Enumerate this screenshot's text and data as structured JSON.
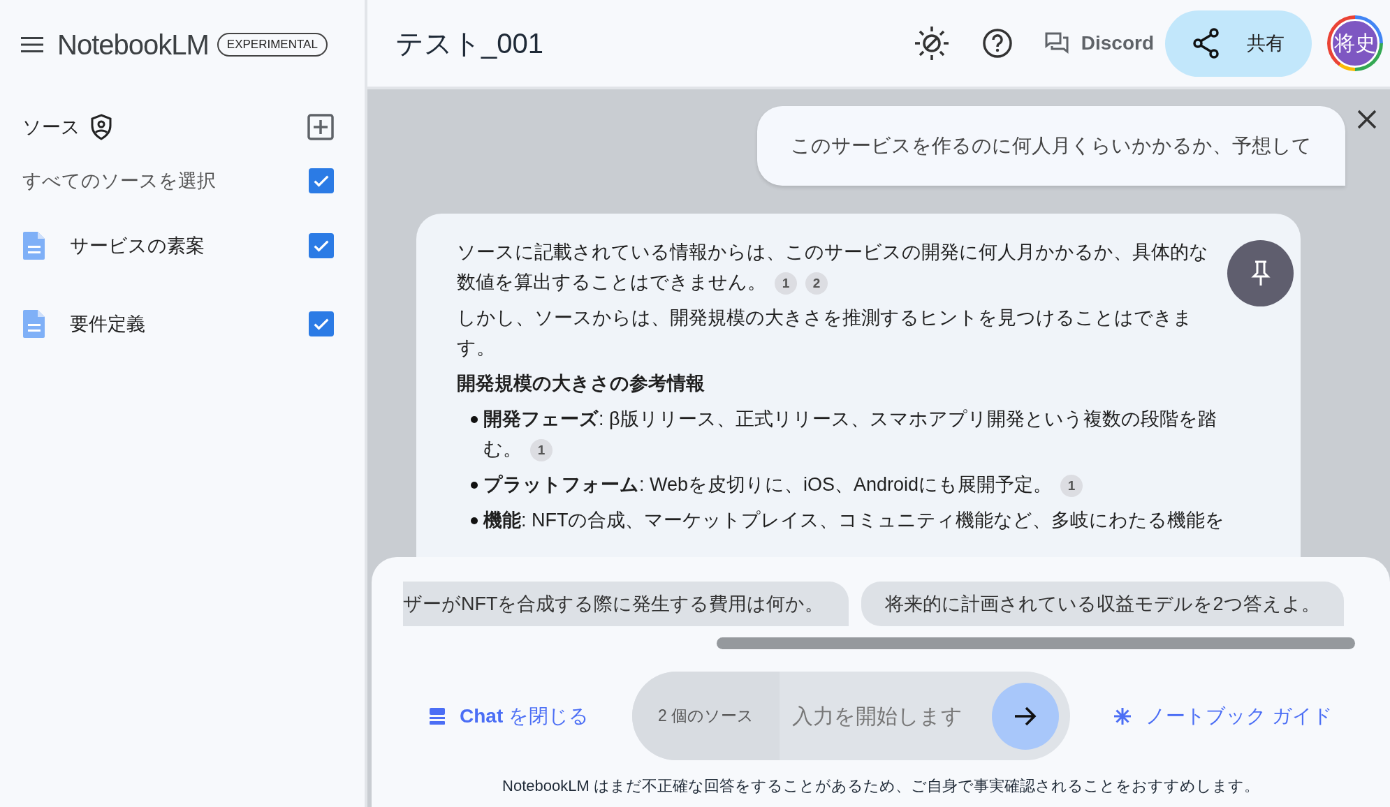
{
  "sidebar": {
    "app_name": "NotebookLM",
    "badge": "EXPERIMENTAL",
    "sources_label": "ソース",
    "select_all": {
      "label": "すべてのソースを選択",
      "checked": true
    },
    "sources": [
      {
        "title": "サービスの素案",
        "checked": true
      },
      {
        "title": "要件定義",
        "checked": true
      }
    ]
  },
  "header": {
    "notebook_title": "テスト_001",
    "discord": "Discord",
    "share": "共有",
    "avatar": "将史"
  },
  "chat": {
    "question": "このサービスを作るのに何人月くらいかかるか、予想して",
    "answer": [
      {
        "kind": "paragraph",
        "text": "ソースに記載されている情報からは、このサービスの開発に何人月かかるか、具体的な数値を算出することはできません。",
        "citations": [
          "1",
          "2"
        ]
      },
      {
        "kind": "paragraph",
        "text": "しかし、ソースからは、開発規模の大きさを推測するヒントを見つけることはできます。"
      },
      {
        "kind": "heading",
        "text": "開発規模の大きさの参考情報"
      },
      {
        "kind": "bullet",
        "text": "**開発フェーズ**: β版リリース、正式リリース、スマホアプリ開発という複数の段階を踏む。",
        "citations": [
          "1"
        ]
      },
      {
        "kind": "bullet",
        "text": "**プラットフォーム**: Webを皮切りに、iOS、Androidにも展開予定。",
        "citations": [
          "1"
        ]
      },
      {
        "kind": "bullet",
        "text": "**機能**: NFTの合成、マーケットプレイス、コミュニティ機能など、多岐にわたる機能を"
      }
    ]
  },
  "composer": {
    "suggestions": [
      "ザーがNFTを合成する際に発生する費用は何か。",
      "将来的に計画されている収益モデルを2つ答えよ。"
    ],
    "close_chat": "**Chat** を閉じる",
    "source_count": "2 個のソース",
    "placeholder": "入力を開始します",
    "guide": "ノートブック ガイド",
    "disclaimer": "NotebookLM はまだ不正確な回答をすることがあるため、ご自身で事実確認されることをおすすめします。"
  }
}
